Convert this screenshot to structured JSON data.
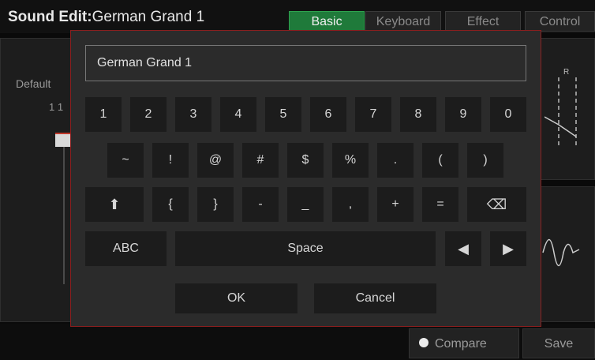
{
  "header": {
    "title_prefix": "Sound Edit:",
    "title_name": "German Grand 1",
    "tabs": [
      {
        "label": "Basic",
        "active": true
      },
      {
        "label": "Keyboard",
        "active": false
      },
      {
        "label": "Effect",
        "active": false
      },
      {
        "label": "Control",
        "active": false
      }
    ]
  },
  "background": {
    "default_label": "Default",
    "value_label": "1 1",
    "compare_label": "Compare",
    "save_label": "Save"
  },
  "keyboard": {
    "name_value": "German Grand 1",
    "row1": [
      "1",
      "2",
      "3",
      "4",
      "5",
      "6",
      "7",
      "8",
      "9",
      "0"
    ],
    "row2": [
      "~",
      "!",
      "@",
      "#",
      "$",
      "%",
      ".",
      "(",
      ")"
    ],
    "row3": [
      "⬆",
      "{",
      "}",
      "-",
      "_",
      ",",
      "+",
      "=",
      "⌫"
    ],
    "row4": {
      "abc": "ABC",
      "space": "Space",
      "left": "◀",
      "right": "▶"
    },
    "ok_label": "OK",
    "cancel_label": "Cancel"
  },
  "colors": {
    "active_tab": "#1f7a3a",
    "modal_border": "#8b1e1e",
    "key_bg": "#1c1c1c"
  }
}
